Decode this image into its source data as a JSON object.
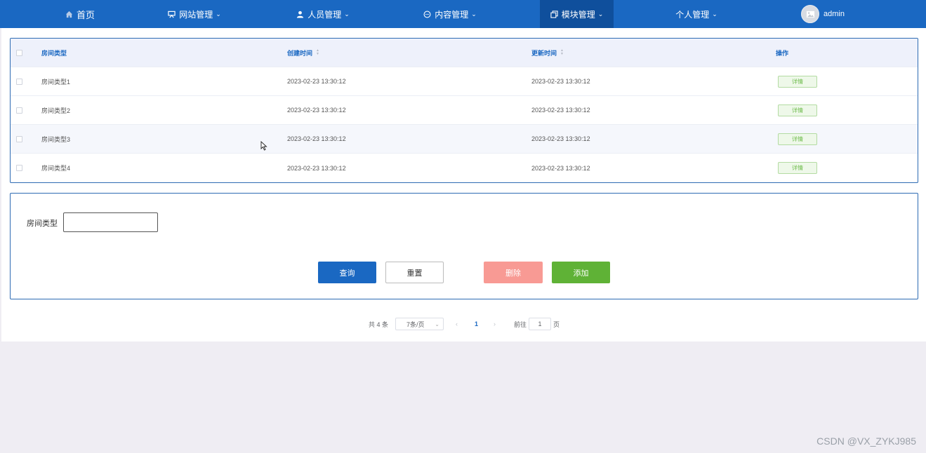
{
  "nav": {
    "items": [
      {
        "label": "首页",
        "icon": "home-icon"
      },
      {
        "label": "网站管理",
        "icon": "monitor-icon"
      },
      {
        "label": "人员管理",
        "icon": "user-icon"
      },
      {
        "label": "内容管理",
        "icon": "chat-icon"
      },
      {
        "label": "模块管理",
        "icon": "copy-icon"
      },
      {
        "label": "个人管理",
        "icon": ""
      }
    ],
    "user": {
      "name": "admin",
      "avatar_icon": "image-icon"
    }
  },
  "table": {
    "columns": [
      "房间类型",
      "创建时间",
      "更新时间",
      "操作"
    ],
    "rows": [
      {
        "room_type": "房间类型1",
        "created": "2023-02-23 13:30:12",
        "updated": "2023-02-23 13:30:12",
        "action": "详情"
      },
      {
        "room_type": "房间类型2",
        "created": "2023-02-23 13:30:12",
        "updated": "2023-02-23 13:30:12",
        "action": "详情"
      },
      {
        "room_type": "房间类型3",
        "created": "2023-02-23 13:30:12",
        "updated": "2023-02-23 13:30:12",
        "action": "详情"
      },
      {
        "room_type": "房间类型4",
        "created": "2023-02-23 13:30:12",
        "updated": "2023-02-23 13:30:12",
        "action": "详情"
      }
    ]
  },
  "search": {
    "label": "房间类型",
    "value": "",
    "query_label": "查询",
    "reset_label": "重置",
    "delete_label": "删除",
    "add_label": "添加"
  },
  "pagination": {
    "total": "共 4 条",
    "page_size": "7条/页",
    "current_page": "1",
    "goto_label": "前往",
    "goto_value": "1",
    "page_suffix": "页"
  },
  "watermark": "CSDN @VX_ZYKJ985",
  "colors": {
    "nav": "#1a68c2",
    "nav_active": "#0f4f9c",
    "delete": "#f89a94",
    "add": "#5fb236"
  }
}
